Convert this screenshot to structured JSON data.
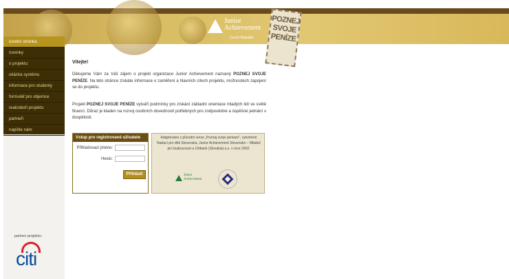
{
  "header": {
    "logo_line1": "Junior",
    "logo_line2": "Achievement",
    "logo_sub": "Czech Republic",
    "stamp_lines": [
      "POZNEJ",
      "SVOJE",
      "PENÍZE"
    ]
  },
  "sidebar": {
    "items": [
      {
        "label": "úvodní stránka",
        "active": true
      },
      {
        "label": "novinky"
      },
      {
        "label": "o projektu"
      },
      {
        "label": "ukázka systému"
      },
      {
        "label": "informace pro studenty"
      },
      {
        "label": "formulář pro objemce"
      },
      {
        "label": "realizátoři projektu"
      },
      {
        "label": "partneři"
      },
      {
        "label": "napište nám"
      }
    ],
    "partner_label": "partner projektu:",
    "partner_logo": "citi"
  },
  "main": {
    "welcome": "Vítejte!",
    "p1_a": "Děkujeme Vám za Váš zájem o projekt organizace Junior Achievement nazvaný ",
    "p1_b": "POZNEJ SVOJE PENÍZE",
    "p1_c": ". Na této stránce získáte informace o zaměření a hlavních cílech projektu, možnostech zapojení se do projektu.",
    "p2_a": "Projekt ",
    "p2_b": "POZNEJ SVOJE PENÍZE",
    "p2_c": " vytváří podmínky pro získání základní orientace mladých lidí ve světě financí. Důraz je kladen na rozvoj osobních dovedností potřebných pro zodpovědné a úspěšné jednání v dospělosti."
  },
  "login": {
    "title": "Vstup pro registrované uživatele",
    "username_label": "Přihlašovací jméno:",
    "password_label": "Heslo:",
    "submit_label": "Přihlásit"
  },
  "info": {
    "text": "Adaptováno z původní verze „Poznaj svoje peniaze\", vytvořené Nadací pro děti Slovenska, Junior Achievement Slovensko – Mládež pro budoucnost a Citibank (Slovakia) a.s. v roce 2002.",
    "ja_line1": "Junior",
    "ja_line2": "Achievement"
  },
  "colors": {
    "menu_bg": "#3d2e05",
    "menu_active": "#b7941d",
    "header_gold": "#d9bd63"
  }
}
